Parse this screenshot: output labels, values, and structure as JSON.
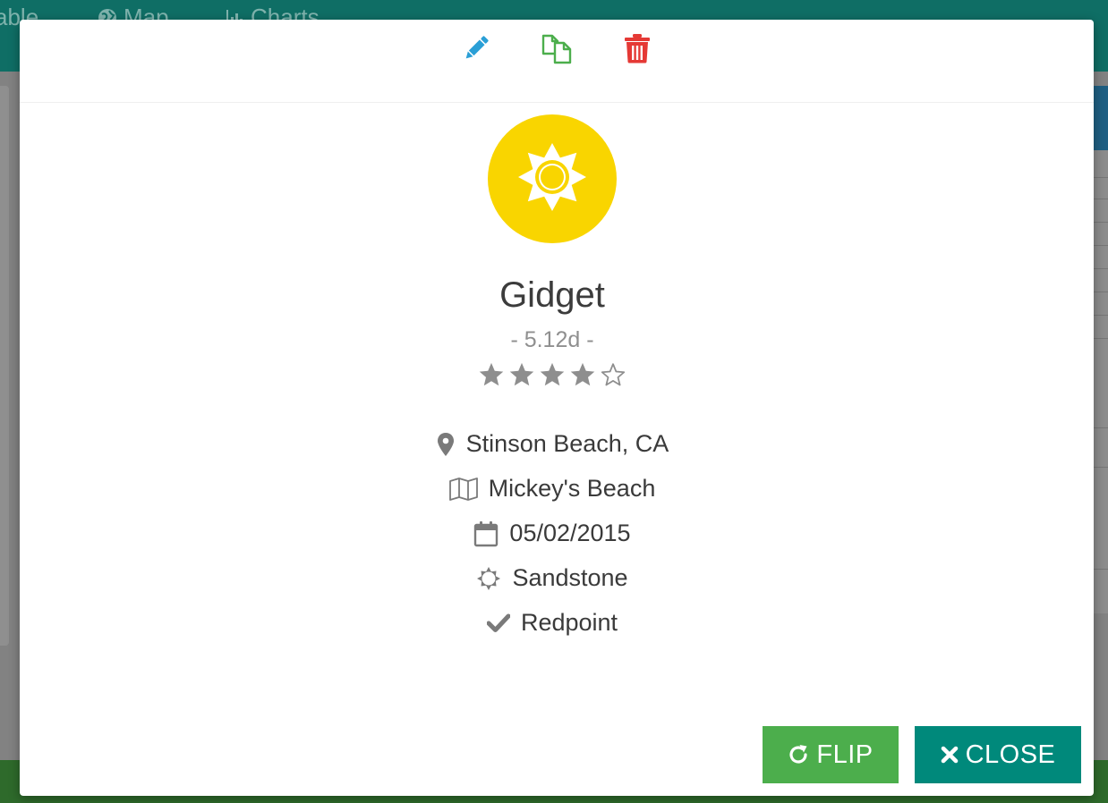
{
  "navbar": {
    "items": [
      {
        "label": "able",
        "icon": "table-icon"
      },
      {
        "label": "Map",
        "icon": "globe-icon"
      },
      {
        "label": "Charts",
        "icon": "bar-chart-icon"
      }
    ]
  },
  "modal": {
    "header_actions": [
      {
        "name": "edit",
        "icon": "pencil-icon",
        "color": "#2a9fd6"
      },
      {
        "name": "copy",
        "icon": "copy-icon",
        "color": "#4cae4c"
      },
      {
        "name": "delete",
        "icon": "trash-icon",
        "color": "#e53935"
      }
    ],
    "avatar": {
      "icon": "sun-icon",
      "color": "#f9d500"
    },
    "route": {
      "name": "Gidget",
      "grade": "- 5.12d -",
      "rating": 4,
      "rating_max": 5
    },
    "details": {
      "location": "Stinson Beach, CA",
      "area": "Mickey's Beach",
      "date": "05/02/2015",
      "rock_type": "Sandstone",
      "style": "Redpoint"
    },
    "buttons": {
      "flip_label": "FLIP",
      "close_label": "CLOSE"
    }
  },
  "colors": {
    "primary": "#00897b",
    "success": "#4cae4c",
    "danger": "#e53935",
    "info": "#2a9fd6",
    "icon_gray": "#7a7a7a"
  }
}
